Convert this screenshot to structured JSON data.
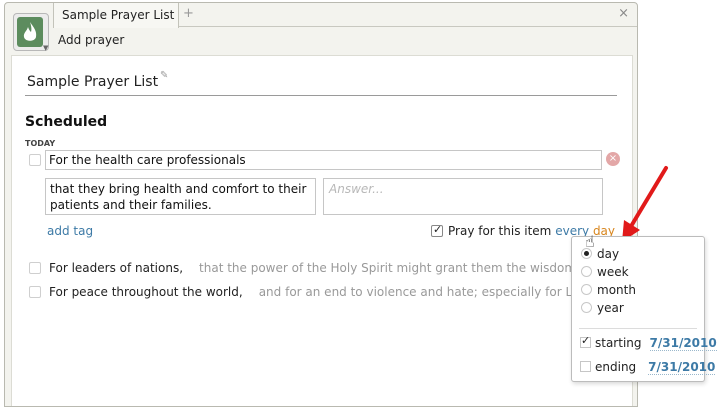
{
  "tabs": [
    {
      "label": "Sample Prayer List"
    }
  ],
  "tab_add_label": "+",
  "tab_close_label": "×",
  "toolbar": {
    "add_prayer_label": "Add prayer"
  },
  "list": {
    "title": "Sample Prayer List",
    "section_title": "Scheduled",
    "group_label": "TODAY",
    "active_item": {
      "text": "For the health care professionals",
      "description_line1": "that they bring health and comfort to their",
      "description_line2": "patients and their families.",
      "answer_placeholder": "Answer...",
      "add_tag_label": "add tag",
      "pray_label": "Pray for this item",
      "frequency_prefix": "every",
      "frequency_value": "day"
    },
    "items": [
      {
        "title": "For leaders of nations,",
        "note": "that the power of the Holy Spirit might grant them the wisdom to..."
      },
      {
        "title": "For peace throughout the world,",
        "note": "and for an end to violence and hate; especially for Lebanon,"
      }
    ]
  },
  "frequency_popover": {
    "options": [
      "day",
      "week",
      "month",
      "year"
    ],
    "selected": "day",
    "starting_label": "starting",
    "starting_date": "7/31/2010",
    "starting_checked": true,
    "ending_label": "ending",
    "ending_date": "7/31/2010",
    "ending_checked": false
  },
  "colors": {
    "link": "#3d7aa6",
    "accent": "#d8861e",
    "arrow": "#e11a1a",
    "app_icon": "#5c8c5e"
  }
}
